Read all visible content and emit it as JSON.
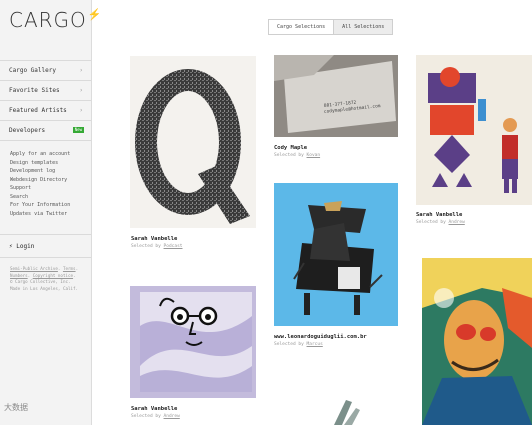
{
  "logo": {
    "text": "CARGO",
    "mark": "⚡"
  },
  "sidebar": {
    "items": [
      {
        "label": "Cargo Gallery"
      },
      {
        "label": "Favorite Sites"
      },
      {
        "label": "Featured Artists"
      },
      {
        "label": "Developers",
        "badge": "New"
      }
    ],
    "dev_links": [
      "Apply for an account",
      "Design templates",
      "Development log",
      "Webdesign Directory",
      "Support",
      "Search",
      "For Your Information",
      "Updates via Twitter"
    ],
    "login_label": "Login",
    "footer": {
      "line1": "Semi-Public Archive",
      "line1b": "Terms",
      "line2": "Numbers",
      "line2b": "Copyright notice",
      "line3": "© Cargo Collective, Inc.",
      "line4": "Made in Los Angeles, Calif."
    }
  },
  "toggle": {
    "left": "Cargo Selections",
    "right": "All Selections"
  },
  "gallery": [
    {
      "title": "Sarah Vanbelle",
      "selected_prefix": "Selected by",
      "selector": "Podcast"
    },
    {
      "title": "Cody Maple",
      "selected_prefix": "Selected by",
      "selector": "Kovan"
    },
    {
      "title": "Sarah Vanbelle",
      "selected_prefix": "Selected by",
      "selector": "Andrew"
    },
    {
      "title": "www.leonardoguiduglii.com.br",
      "selected_prefix": "Selected by",
      "selector": "Marcus"
    },
    {
      "title": "Sarah Vanbelle",
      "selected_prefix": "Selected by",
      "selector": "Andrew"
    }
  ],
  "card_text": [
    "801-377-1872",
    "codymaple@hotmail.com"
  ],
  "watermark": "大数据"
}
